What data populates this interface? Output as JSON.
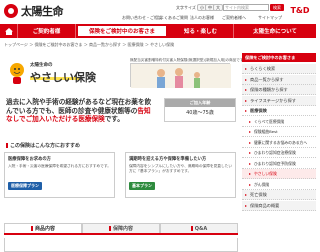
{
  "header": {
    "brand": "太陽生命",
    "font_size_label": "文字サイズ",
    "font_size_buttons": [
      "小",
      "中",
      "大"
    ],
    "utility_links": [
      "お問い合わせ・ご相談",
      "よくあるご質問",
      "サイトマップ"
    ],
    "subscriber_link": "ご契約者様へ",
    "corporate_link": "法人のお客様",
    "search_placeholder": "サイト内検索",
    "search_button": "検索",
    "group_logo": "T&D"
  },
  "gnav": {
    "items": [
      {
        "label": "ご契約者様"
      },
      {
        "label": "保険をご検討中のお客さま"
      },
      {
        "label": "知る・楽しむ"
      },
      {
        "label": "太陽生命について"
      }
    ],
    "active_index": 1
  },
  "breadcrumb": "トップページ ＞ 保険をご検討中のお客さま ＞ 商品一覧から探す ＞ 医療保険 ＞ やさしい保険",
  "hero": {
    "corp": "太陽生命の",
    "product_name": "やさしい保険",
    "note": "無配当災害割増特約付災害入院保険(無選択型)[新規加入用]の商品です"
  },
  "catch": {
    "line1": "過去に入院や手術の経験があるなど現在お薬を飲んでいる方でも、医師の診査や健康状態等の",
    "highlight": "告知なしでご加入いただける医療保険",
    "line_end": "です。",
    "age_header": "ご加入年齢",
    "age_value": "40歳〜75歳"
  },
  "fit": {
    "title": "この保険はこんな方におすすめ",
    "cards": [
      {
        "heading": "医療保障をお求めの方",
        "body": "入院・手術・災害の医療保障を希望される方におすすめです。",
        "button": "医療保障プラン",
        "color": "#1f5fa8"
      },
      {
        "heading": "満期時を迎える方や保障を準備したい方",
        "body": "保障内容をシンプルにしたい方や、満期時の保障を見直したい方に「基本プラン」がおすすめです。",
        "button": "基本プラン",
        "color": "#2e8b3e"
      }
    ]
  },
  "tabs": [
    {
      "label": "商品内容"
    },
    {
      "label": "保障内容"
    },
    {
      "label": "Q&A"
    }
  ],
  "sidebar": {
    "header": "保険をご検討中のお客さま",
    "items": [
      {
        "label": "らくらく検索",
        "type": ""
      },
      {
        "label": "商品一覧から探す",
        "type": ""
      },
      {
        "label": "保険の種類から探す",
        "type": ""
      },
      {
        "label": "ライフステージから探す",
        "type": ""
      },
      {
        "label": "医療保険",
        "type": "title"
      },
      {
        "label": "くらべて医療保険",
        "type": "sub"
      },
      {
        "label": "保険組曲Best",
        "type": "sub"
      },
      {
        "label": "健康に関するお悩みのある方へ",
        "type": "sub"
      },
      {
        "label": "ひまわり認知症治療保険",
        "type": "sub"
      },
      {
        "label": "ひまわり認知症予防保険",
        "type": "sub"
      },
      {
        "label": "やさしい保険",
        "type": "cur"
      },
      {
        "label": "がん保険",
        "type": "sub"
      },
      {
        "label": "死亡保険",
        "type": ""
      },
      {
        "label": "保険商品の概要",
        "type": ""
      }
    ]
  }
}
